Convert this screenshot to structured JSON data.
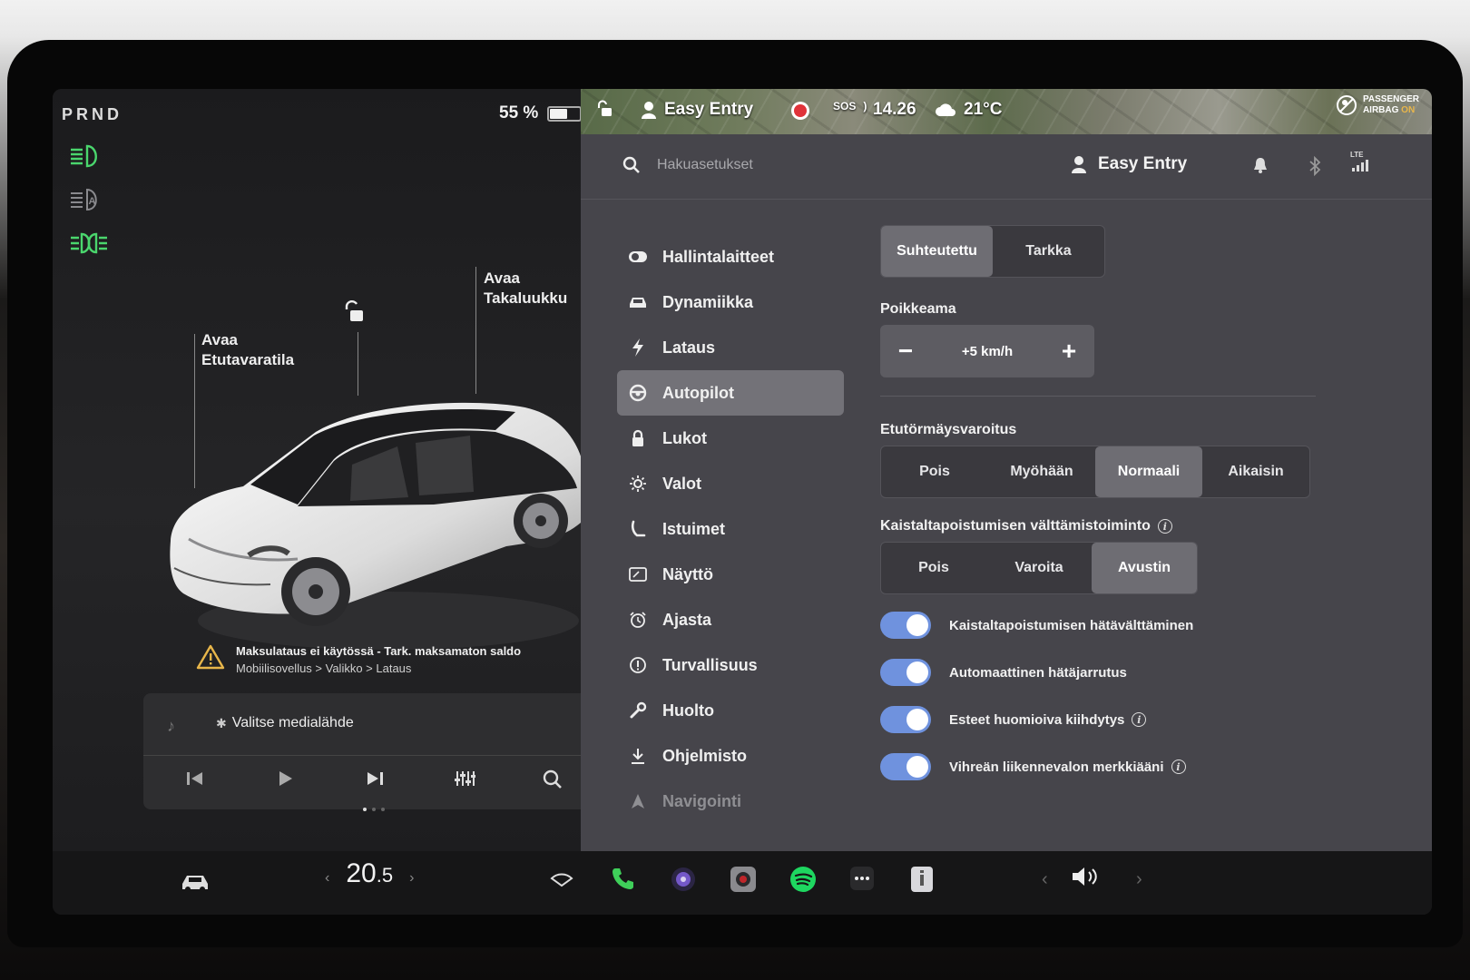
{
  "gear": "PRND",
  "battery": {
    "percent_label": "55 %",
    "level": 0.55
  },
  "car": {
    "frunk_label_1": "Avaa",
    "frunk_label_2": "Etutavaratila",
    "trunk_label_1": "Avaa",
    "trunk_label_2": "Takaluukku"
  },
  "warning": {
    "title": "Maksulataus ei käytössä - Tark. maksamaton saldo",
    "path": "Mobiilisovellus > Valikko > Lataus"
  },
  "media": {
    "source_label": "Valitse medialähde"
  },
  "status_bar": {
    "driver_profile": "Easy Entry",
    "sos": "SOS",
    "time": "14.26",
    "temperature": "21°C",
    "airbag_line1": "PASSENGER",
    "airbag_line2": "AIRBAG",
    "airbag_state": "ON"
  },
  "topbar": {
    "search_placeholder": "Hakuasetukset",
    "profile_name": "Easy Entry",
    "signal_label": "LTE"
  },
  "nav": {
    "items": [
      {
        "label": "Hallintalaitteet",
        "icon": "toggle-icon"
      },
      {
        "label": "Dynamiikka",
        "icon": "car-icon"
      },
      {
        "label": "Lataus",
        "icon": "bolt-icon"
      },
      {
        "label": "Autopilot",
        "icon": "steering-wheel-icon",
        "active": true
      },
      {
        "label": "Lukot",
        "icon": "lock-icon"
      },
      {
        "label": "Valot",
        "icon": "sun-icon"
      },
      {
        "label": "Istuimet",
        "icon": "seat-icon"
      },
      {
        "label": "Näyttö",
        "icon": "display-icon"
      },
      {
        "label": "Ajasta",
        "icon": "alarm-icon"
      },
      {
        "label": "Turvallisuus",
        "icon": "alert-circle-icon"
      },
      {
        "label": "Huolto",
        "icon": "wrench-icon"
      },
      {
        "label": "Ohjelmisto",
        "icon": "download-icon"
      },
      {
        "label": "Navigointi",
        "icon": "navigation-icon"
      }
    ]
  },
  "autopilot": {
    "speed_mode": {
      "options": [
        "Suhteutettu",
        "Tarkka"
      ],
      "selected": "Suhteutettu"
    },
    "offset": {
      "title": "Poikkeama",
      "value": "+5 km/h",
      "minus": "−",
      "plus": "+"
    },
    "fcw": {
      "title": "Etutörmäysvaroitus",
      "options": [
        "Pois",
        "Myöhään",
        "Normaali",
        "Aikaisin"
      ],
      "selected": "Normaali"
    },
    "lane": {
      "title": "Kaistaltapoistumisen välttämistoiminto",
      "options": [
        "Pois",
        "Varoita",
        "Avustin"
      ],
      "selected": "Avustin"
    },
    "toggles": [
      {
        "label": "Kaistaltapoistumisen hätävälttäminen",
        "on": true,
        "info": false
      },
      {
        "label": "Automaattinen hätäjarrutus",
        "on": true,
        "info": false
      },
      {
        "label": "Esteet huomioiva kiihdytys",
        "on": true,
        "info": true
      },
      {
        "label": "Vihreän liikennevalon merkkiääni",
        "on": true,
        "info": true
      }
    ]
  },
  "bottom_bar": {
    "temp_whole": "20",
    "temp_decimal": ".5",
    "colors": {
      "accent_blue": "#6f92de",
      "phone_green": "#3fcf5a",
      "spotify_green": "#1ed760"
    }
  }
}
